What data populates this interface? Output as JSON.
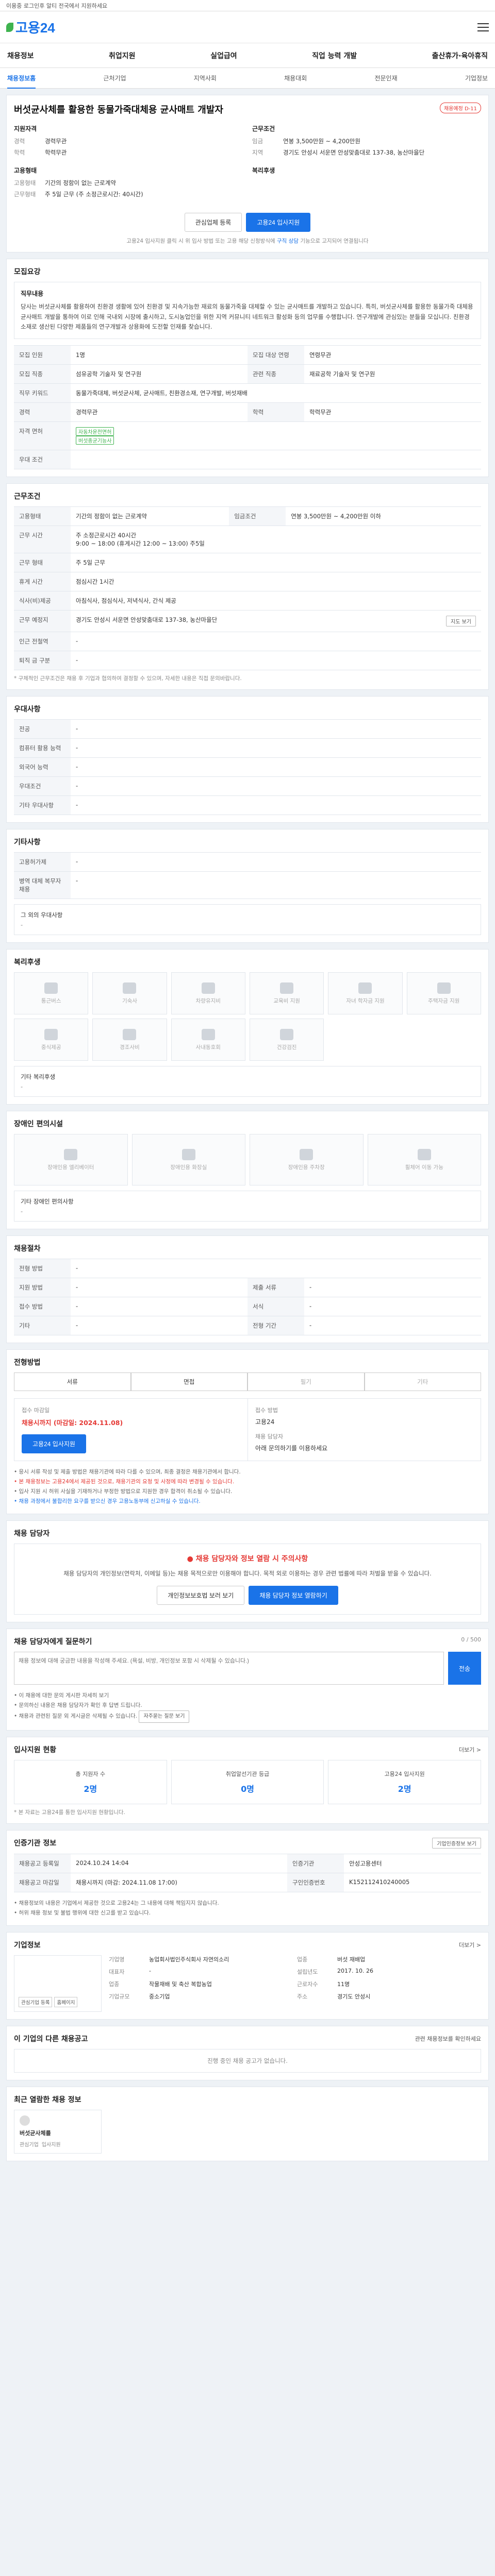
{
  "topbar": {
    "left": "이용중 로그인후 알티 전국에서 지원하세요",
    "right": ""
  },
  "brand": {
    "logo_text": "고용24"
  },
  "gnb": [
    "채용정보",
    "취업지원",
    "실업급여",
    "직업 능력 개발",
    "출산휴가·육아휴직"
  ],
  "subnav": [
    "채용정보홈",
    "근처기업",
    "지역사회",
    "채용대회",
    "전문인재",
    "기업정보"
  ],
  "summary": {
    "title": "버섯균사체를 활용한 동물가죽대체용 균사매트 개발자",
    "badge": "채용예정 D-11",
    "left_head": "지원자격",
    "left_rows": [
      {
        "k": "경력",
        "v": "경력무관"
      },
      {
        "k": "학력",
        "v": "학력무관"
      }
    ],
    "right_head": "근무조건",
    "right_rows": [
      {
        "k": "임금",
        "v": "연봉 3,500만원 ~ 4,200만원"
      },
      {
        "k": "지역",
        "v": "경기도 안성시 서운면 안성맞춤대로 137-38, 농산마을단"
      }
    ],
    "left_head2": "고용형태",
    "left_rows2": [
      {
        "k": "고용형태",
        "v": "기간의 정함이 없는 근로계약"
      },
      {
        "k": "근무형태",
        "v": "주 5일 근무 (주 소정근로시간: 40시간)"
      }
    ],
    "right_head2": "복리후생",
    "right_rows2": [],
    "btn_interest": "관심업체 등록",
    "btn_apply": "고용24 입사지원",
    "note": "고용24 입사지원 클릭 시 위 입사 방법 또는 고용 해당 신청방식에 ",
    "note_link": "구직 상담",
    "note_tail": " 기능으로 고지되어 연결됩니다"
  },
  "recruit": {
    "title": "모집요강",
    "desc_head": "직무내용",
    "desc": "당사는 버섯균사체를 활용하여 친환경 생활에 있어 친환경 및 지속가능한 재료의 동물가죽을 대체할 수 있는 균사매트를 개발하고 있습니다. 특히, 버섯균사체를 활용한 동물가죽 대체용 균사매트 개발을 통하여 이로 인해 국내외 시장에 출시하고, 도시농업인을 위한 지역 커뮤니티 네트워크 활성화 등의 업무를 수행합니다. 연구개발에 관심있는 분들을 모십니다. 친환경 소재로 생산된 다양한 제품들의 연구개발과 상용화에 도전할 인재를 찾습니다.",
    "rows": [
      {
        "k": "모집 인원",
        "v": "1명",
        "k2": "모집 대상 연령",
        "v2": "연령무관"
      },
      {
        "k": "모집 직종",
        "v": "섬유공학 기술자 및 연구원",
        "k2": "관련 직종",
        "v2": "재료공학 기술자 및 연구원"
      },
      {
        "k": "직무 키워드",
        "v": "동물가죽대체, 버섯균사체, 균사매트, 친환경소재, 연구개발, 버섯재배",
        "k2": "",
        "v2": ""
      },
      {
        "k": "경력",
        "v": "경력무관",
        "k2": "학력",
        "v2": "학력무관"
      },
      {
        "k": "자격 면허",
        "v": "식품기사 외 1건",
        "k2": "",
        "v2": ""
      },
      {
        "k": "우대 조건",
        "v": "",
        "k2": "",
        "v2": ""
      }
    ],
    "license_tags": [
      "자동차운전면허",
      "버섯종균기능사"
    ]
  },
  "conditions": {
    "title": "근무조건",
    "rows": [
      {
        "k": "고용형태",
        "v": "기간의 정함이 없는 근로계약",
        "k2": "임금조건",
        "v2": "연봉 3,500만원 ~ 4,200만원 이하"
      },
      {
        "k": "근무 시간",
        "v": "주 소정근로시간 40시간",
        "k2": "",
        "v2": ""
      },
      {
        "k": "근무 형태",
        "v": "주 5일 근무",
        "k2": "",
        "v2": ""
      },
      {
        "k": "휴게 시간",
        "v": "점심시간 1시간",
        "k2": "",
        "v2": ""
      },
      {
        "k": "식사(비)제공",
        "v": "아침식사, 점심식사, 저녁식사, 간식 제공",
        "k2": "",
        "v2": ""
      },
      {
        "k": "근무 예정지",
        "v": "경기도 안성시 서운면 안성맞춤대로 137-38, 농산마을단",
        "k2": "",
        "v2": ""
      },
      {
        "k": "인근 전철역",
        "v": "-",
        "k2": "",
        "v2": ""
      },
      {
        "k": "퇴직 금 구분",
        "v": "-",
        "k2": "",
        "v2": ""
      }
    ],
    "times": "9:00 ~ 18:00 (휴게시간 12:00 ~ 13:00) 주5일",
    "map_btn": "지도 보기",
    "footnote": "* 구체적인 근무조건은 채용 후 기업과 협의하여 결정할 수 있으며, 자세한 내용은 직접 문의바랍니다."
  },
  "preferred": {
    "title": "우대사항",
    "rows": [
      {
        "k": "전공",
        "v": "-"
      },
      {
        "k": "컴퓨터 활용 능력",
        "v": "-"
      },
      {
        "k": "외국어 능력",
        "v": "-"
      },
      {
        "k": "우대조건",
        "v": "-"
      },
      {
        "k": "기타 우대사항",
        "v": "-"
      }
    ]
  },
  "other": {
    "title": "기타사항",
    "rows": [
      {
        "k": "고용허가제",
        "v": "-"
      },
      {
        "k": "병역 대체 복무자 채용",
        "v": "-"
      }
    ],
    "extra": "그 외의 우대사항",
    "extra_val": "-"
  },
  "welfare": {
    "title": "복리후생",
    "items": [
      "통근버스",
      "기숙사",
      "차량유지비",
      "교육비 지원",
      "자녀 학자금 지원",
      "주택자금 지원",
      "중식제공",
      "경조사비",
      "사내동호회",
      "건강검진"
    ],
    "extra": "기타 복리후생",
    "extra_val": "-"
  },
  "disability": {
    "title": "장애인 편의시설",
    "items": [
      "장애인용 엘리베이터",
      "장애인용 화장실",
      "장애인용 주차장",
      "휠체어 이동 가능"
    ],
    "extra": "기타 장애인 편의사항",
    "extra_val": "-"
  },
  "selection": {
    "title": "채용절차",
    "rows": [
      {
        "k": "전형 방법",
        "v": "-",
        "k2": "",
        "v2": ""
      },
      {
        "k": "지원 방법",
        "v": "-",
        "k2": "제출 서류",
        "v2": "-"
      },
      {
        "k": "접수 방법",
        "v": "-",
        "k2": "서식",
        "v2": "-"
      },
      {
        "k": "기타",
        "v": "-",
        "k2": "전형 기간",
        "v2": "-"
      }
    ]
  },
  "process": {
    "title": "전형방법",
    "steps": [
      "서류",
      "면접",
      "필기",
      "기타"
    ]
  },
  "apply": {
    "period_label": "접수 마감일",
    "period": "채용시까지 (마감일: 2024.11.08)",
    "method_label": "접수 방법",
    "method": "고용24",
    "btn": "고용24 입사지원",
    "contact_label": "채용 담당자",
    "contact": "아래 문의하기를 이용하세요",
    "bullets": [
      "• 응시 서류 작성 및 제출 방법은 채용기관에 따라 다를 수 있으며, 최종 결정은 채용기관에서 합니다.",
      "• 본 채용정보는 고용24에서 제공된 것으로, 채용기관의 요청 및 사정에 따라 변경될 수 있습니다.",
      "• 입사 지원 시 허위 사실을 기재하거나 부정한 방법으로 지원한 경우 합격이 취소될 수 있습니다.",
      "• 채용 과정에서 불합리한 요구를 받으신 경우 고용노동부에 신고하실 수 있습니다."
    ]
  },
  "chat": {
    "title": "채용 담당자",
    "alert": "● 채용 담당자와 정보 열람 시 주의사항",
    "body": "채용 담당자의 개인정보(연락처, 이메일 등)는 채용 목적으로만 이용해야 합니다. 목적 외로 이용하는 경우 관련 법률에 따라 처벌을 받을 수 있습니다.",
    "btn1": "개인정보보호법 보러 보기",
    "btn2": "채용 담당자 정보 열람하기"
  },
  "inquiry": {
    "title": "채용 담당자에게 질문하기",
    "counter": "0 / 500",
    "placeholder": "채용 정보에 대해 궁금한 내용을 작성해 주세요. (욕설, 비방, 개인정보 포함 시 삭제될 수 있습니다.)",
    "send": "전송",
    "notes": [
      "• 이 채용에 대한 문의 게시판 자세히 보기",
      "• 문의하신 내용은 채용 담당자가 확인 후 답변 드립니다.",
      "• 채용과 관련된 질문 외 게시글은 삭제될 수 있습니다."
    ],
    "notes_btn": "자주묻는 질문 보기"
  },
  "stats": {
    "title": "입사지원 현황",
    "more": "더보기 >",
    "cards": [
      {
        "lbl": "총 지원자 수",
        "num": "2명"
      },
      {
        "lbl": "취업알선기관 등급",
        "num": "0명"
      },
      {
        "lbl": "고용24 입사지원",
        "num": "2명"
      }
    ],
    "note": "* 본 자료는 고용24를 통한 입사지원 현황입니다."
  },
  "registry": {
    "title": "인증기관 정보",
    "btn": "기업인증정보 보기",
    "rows": [
      {
        "k": "채용공고 등록일",
        "v": "2024.10.24 14:04",
        "k2": "인증기관",
        "v2": "안성고용센터"
      },
      {
        "k": "채용공고 마감일",
        "v": "채용시까지 (마감: 2024.11.08 17:00)",
        "k2": "구인인증번호",
        "v2": "K152112410240005"
      }
    ],
    "notes": [
      "• 채용정보의 내용은 기업에서 제공한 것으로 고용24는 그 내용에 대해 책임지지 않습니다.",
      "• 허위 채용 정보 및 불법 행위에 대한 신고를 받고 있습니다."
    ]
  },
  "company": {
    "title": "기업정보",
    "more": "더보기 >",
    "logo_btn1": "관심기업 등록",
    "logo_btn2": "홈페이지",
    "rows": [
      {
        "k": "기업명",
        "v": "농업회사법인주식회사 자연의소리",
        "k2": "업종",
        "v2": "버섯 재배업"
      },
      {
        "k": "대표자",
        "v": "-",
        "k2": "설립년도",
        "v2": "2017. 10. 26"
      },
      {
        "k": "업종",
        "v": "작물재배 및 축산 복합농업",
        "k2": "근로자수",
        "v2": "11명"
      },
      {
        "k": "기업규모",
        "v": "중소기업",
        "k2": "주소",
        "v2": "경기도 안성시"
      }
    ]
  },
  "other_jobs": {
    "title": "이 기업의 다른 채용공고",
    "note": "관련 채용정보를 확인하세요",
    "empty": "진행 중인 채용 공고가 없습니다."
  },
  "recent": {
    "title": "최근 열람한 채용 정보",
    "name": "버섯균사체를",
    "actions": [
      "관심기업",
      "입사지원"
    ]
  }
}
